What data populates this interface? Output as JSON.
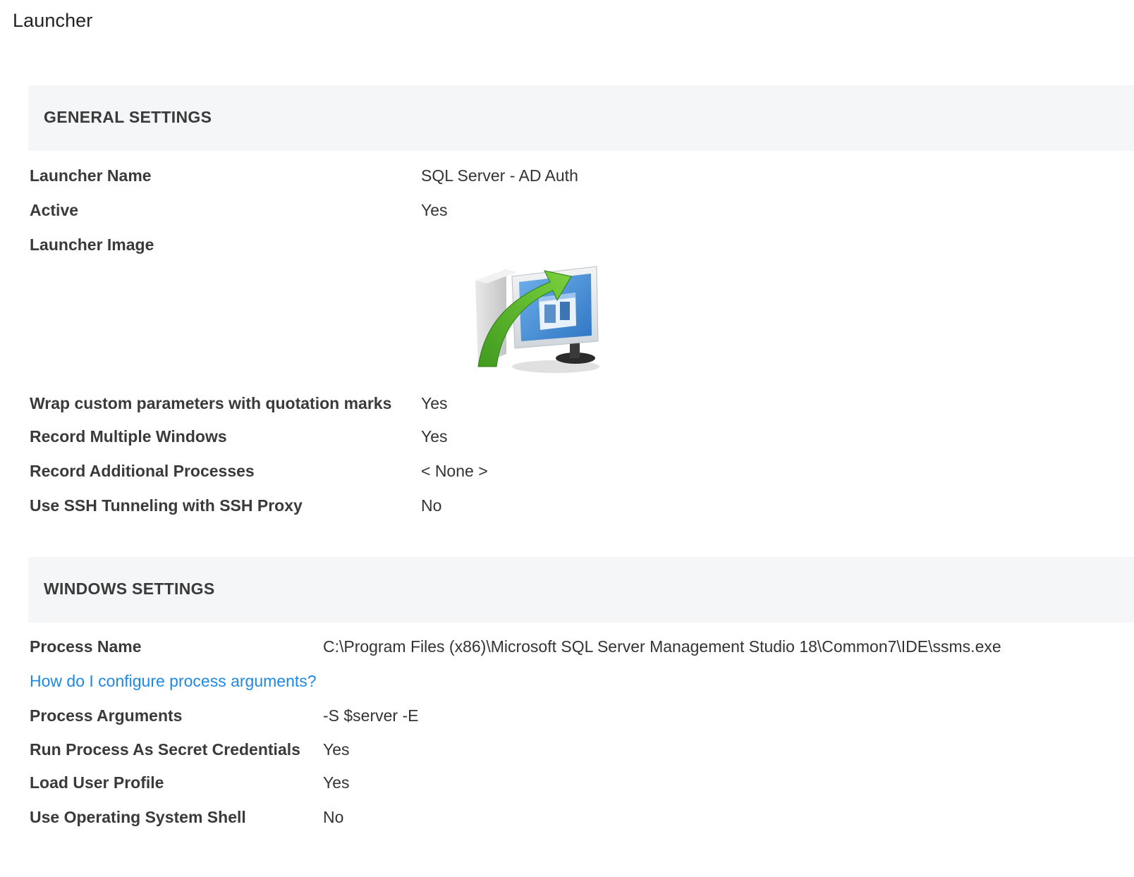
{
  "page": {
    "title": "Launcher"
  },
  "general_settings": {
    "header": "GENERAL SETTINGS",
    "rows": [
      {
        "label": "Launcher Name",
        "value": "SQL Server - AD Auth"
      },
      {
        "label": "Active",
        "value": "Yes"
      },
      {
        "label": "Launcher Image",
        "value": ""
      },
      {
        "label": "Wrap custom parameters with quotation marks",
        "value": "Yes"
      },
      {
        "label": "Record Multiple Windows",
        "value": "Yes"
      },
      {
        "label": "Record Additional Processes",
        "value": "< None >"
      },
      {
        "label": "Use SSH Tunneling with SSH Proxy",
        "value": "No"
      }
    ],
    "launcher_image_icon": "remote-desktop-launcher-icon"
  },
  "windows_settings": {
    "header": "WINDOWS SETTINGS",
    "help_link": "How do I configure process arguments?",
    "rows": [
      {
        "label": "Process Name",
        "value": "C:\\Program Files (x86)\\Microsoft SQL Server Management Studio 18\\Common7\\IDE\\ssms.exe"
      },
      {
        "label": "Process Arguments",
        "value": "-S $server -E"
      },
      {
        "label": "Run Process As Secret Credentials",
        "value": "Yes"
      },
      {
        "label": "Load User Profile",
        "value": "Yes"
      },
      {
        "label": "Use Operating System Shell",
        "value": "No"
      }
    ]
  },
  "colors": {
    "section_background": "#f5f6f7",
    "link": "#1e88e5",
    "arrow_green": "#4caf2a",
    "screen_blue": "#4a90d9"
  }
}
